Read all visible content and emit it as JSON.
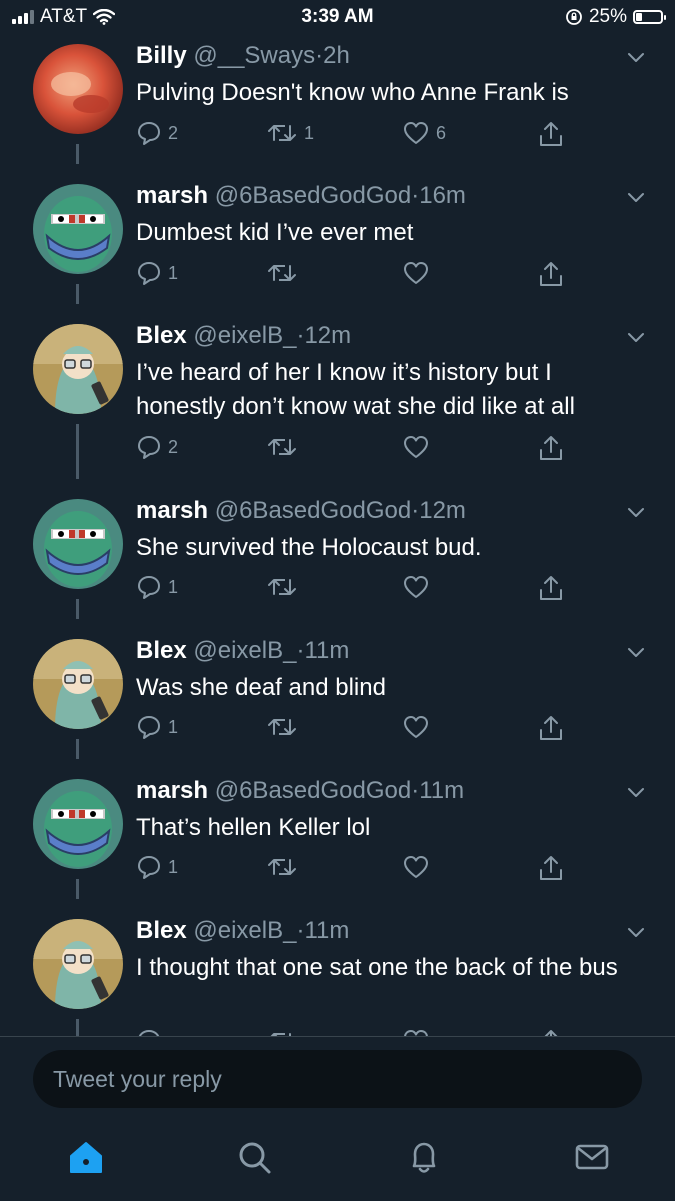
{
  "status_bar": {
    "carrier": "AT&T",
    "time": "3:39 AM",
    "battery": "25%",
    "battery_level": 0.25,
    "signal_bars": 3
  },
  "tweets": [
    {
      "name": "Billy",
      "handle": "@__Sways",
      "time": "2h",
      "text": "Pulving Doesn't know who Anne Frank is",
      "replies": "2",
      "retweets": "1",
      "likes": "6",
      "avatar": "fiery-cloud"
    },
    {
      "name": "marsh",
      "handle": "@6BasedGodGod",
      "time": "16m",
      "text": "Dumbest kid I’ve ever met",
      "replies": "1",
      "retweets": "",
      "likes": "",
      "avatar": "green-cartoon-mask"
    },
    {
      "name": "Blex",
      "handle": "@eixelB_",
      "time": "12m",
      "text": "I’ve heard of her I know it’s history but I honestly don’t know wat she did like at all",
      "replies": "2",
      "retweets": "",
      "likes": "",
      "avatar": "anime-character-field"
    },
    {
      "name": "marsh",
      "handle": "@6BasedGodGod",
      "time": "12m",
      "text": "She survived the Holocaust bud.",
      "replies": "1",
      "retweets": "",
      "likes": "",
      "avatar": "green-cartoon-mask"
    },
    {
      "name": "Blex",
      "handle": "@eixelB_",
      "time": "11m",
      "text": "Was she deaf and blind",
      "replies": "1",
      "retweets": "",
      "likes": "",
      "avatar": "anime-character-field"
    },
    {
      "name": "marsh",
      "handle": "@6BasedGodGod",
      "time": "11m",
      "text": "That’s hellen Keller lol",
      "replies": "1",
      "retweets": "",
      "likes": "",
      "avatar": "green-cartoon-mask"
    },
    {
      "name": "Blex",
      "handle": "@eixelB_",
      "time": "11m",
      "text": "I thought that one sat one the back of the bus",
      "replies": "",
      "retweets": "",
      "likes": "",
      "avatar": "anime-character-field"
    }
  ],
  "reply": {
    "placeholder": "Tweet your reply"
  },
  "tabs": [
    {
      "icon": "home-icon",
      "active": true
    },
    {
      "icon": "search-icon",
      "active": false
    },
    {
      "icon": "bell-icon",
      "active": false
    },
    {
      "icon": "mail-icon",
      "active": false
    }
  ],
  "colors": {
    "background": "#15202b",
    "secondary_text": "#8899a6",
    "accent": "#1da1f2"
  }
}
